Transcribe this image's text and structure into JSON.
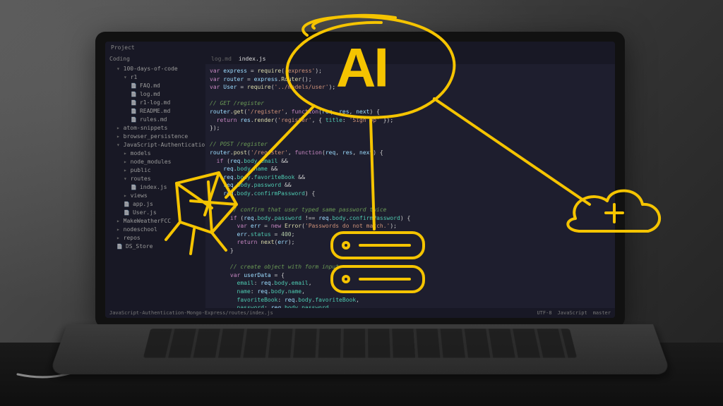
{
  "scene": {
    "overlay_label": "AI",
    "accent": "#f5c400"
  },
  "editor": {
    "project_label": "Project",
    "tabs": [
      "log.md",
      "index.js"
    ],
    "active_tab": 1,
    "sidebar_root": "Coding",
    "sidebar_items": [
      {
        "label": "100-days-of-code",
        "type": "folder-open",
        "indent": 1
      },
      {
        "label": "r1",
        "type": "folder-open",
        "indent": 2
      },
      {
        "label": "FAQ.md",
        "type": "file",
        "indent": 3
      },
      {
        "label": "log.md",
        "type": "file",
        "indent": 3
      },
      {
        "label": "r1-log.md",
        "type": "file",
        "indent": 3
      },
      {
        "label": "README.md",
        "type": "file",
        "indent": 3
      },
      {
        "label": "rules.md",
        "type": "file",
        "indent": 3
      },
      {
        "label": "atom-snippets",
        "type": "folder",
        "indent": 1
      },
      {
        "label": "browser_persistence",
        "type": "folder",
        "indent": 1
      },
      {
        "label": "JavaScript-Authentication-Mongo-Express",
        "type": "folder-open",
        "indent": 1
      },
      {
        "label": "models",
        "type": "folder",
        "indent": 2
      },
      {
        "label": "node_modules",
        "type": "folder",
        "indent": 2
      },
      {
        "label": "public",
        "type": "folder",
        "indent": 2
      },
      {
        "label": "routes",
        "type": "folder-open",
        "indent": 2
      },
      {
        "label": "index.js",
        "type": "file",
        "indent": 3
      },
      {
        "label": "views",
        "type": "folder",
        "indent": 2
      },
      {
        "label": "app.js",
        "type": "file",
        "indent": 2
      },
      {
        "label": "User.js",
        "type": "file",
        "indent": 2
      },
      {
        "label": "MakeWeatherFCC",
        "type": "folder",
        "indent": 1
      },
      {
        "label": "nodeschool",
        "type": "folder",
        "indent": 1
      },
      {
        "label": "repos",
        "type": "folder",
        "indent": 1
      },
      {
        "label": "DS_Store",
        "type": "file",
        "indent": 1
      }
    ],
    "statusbar": {
      "path": "JavaScript-Authentication-Mongo-Express/routes/index.js",
      "encoding": "UTF-8",
      "lang": "JavaScript",
      "branch": "master"
    }
  }
}
